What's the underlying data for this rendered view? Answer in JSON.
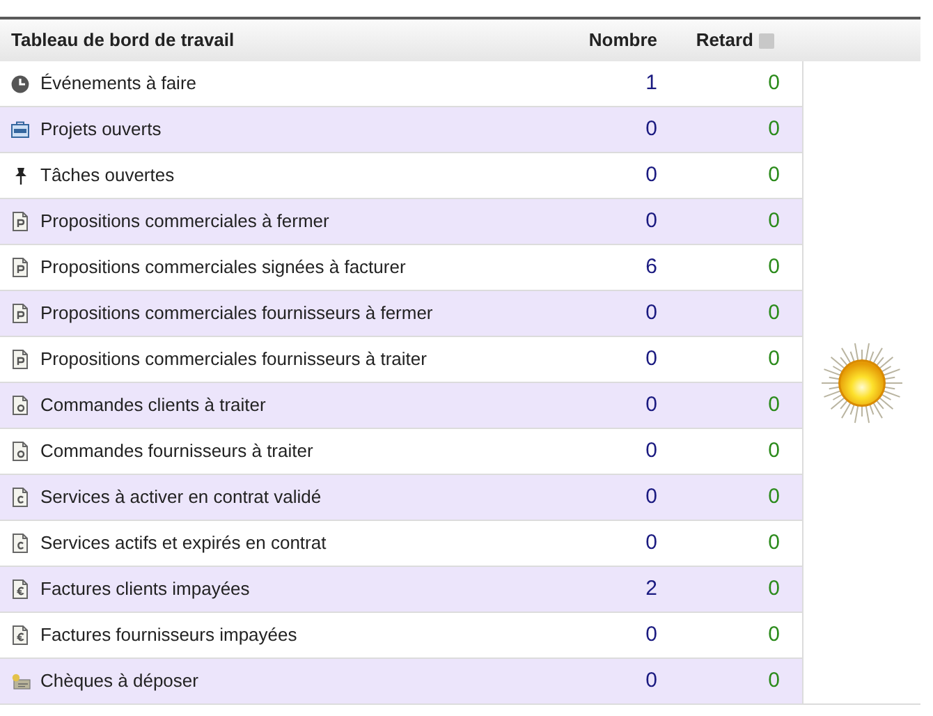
{
  "table": {
    "title": "Tableau de bord de travail",
    "columns": [
      "Nombre",
      "Retard"
    ],
    "rows": [
      {
        "kind": "event",
        "label": "Événements à faire",
        "count": "1",
        "late": "0"
      },
      {
        "kind": "project",
        "label": "Projets ouverts",
        "count": "0",
        "late": "0"
      },
      {
        "kind": "task",
        "label": "Tâches ouvertes",
        "count": "0",
        "late": "0"
      },
      {
        "kind": "proposal",
        "label": "Propositions commerciales à fermer",
        "count": "0",
        "late": "0"
      },
      {
        "kind": "proposal",
        "label": "Propositions commerciales signées à facturer",
        "count": "6",
        "late": "0"
      },
      {
        "kind": "proposal",
        "label": "Propositions commerciales fournisseurs à fermer",
        "count": "0",
        "late": "0"
      },
      {
        "kind": "proposal",
        "label": "Propositions commerciales fournisseurs à traiter",
        "count": "0",
        "late": "0"
      },
      {
        "kind": "order",
        "label": "Commandes clients à traiter",
        "count": "0",
        "late": "0"
      },
      {
        "kind": "order",
        "label": "Commandes fournisseurs à traiter",
        "count": "0",
        "late": "0"
      },
      {
        "kind": "contract",
        "label": "Services à activer en contrat validé",
        "count": "0",
        "late": "0"
      },
      {
        "kind": "contract",
        "label": "Services actifs et expirés en contrat",
        "count": "0",
        "late": "0"
      },
      {
        "kind": "invoice",
        "label": "Factures clients impayées",
        "count": "2",
        "late": "0"
      },
      {
        "kind": "invoice",
        "label": "Factures fournisseurs impayées",
        "count": "0",
        "late": "0"
      },
      {
        "kind": "cheque",
        "label": "Chèques à déposer",
        "count": "0",
        "late": "0"
      }
    ]
  }
}
